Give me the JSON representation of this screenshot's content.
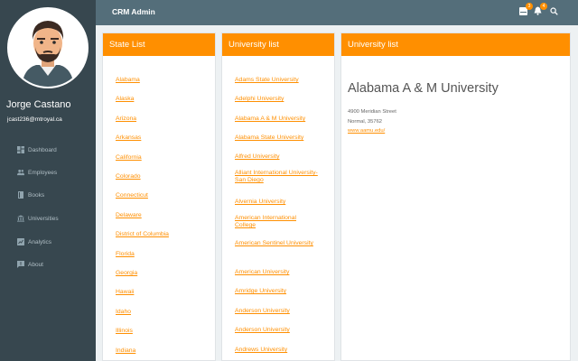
{
  "user": {
    "name": "Jorge Castano",
    "email": "jcast236@mtroyal.ca"
  },
  "app": {
    "title": "CRM Admin"
  },
  "topbar": {
    "badge_mail": "3",
    "badge_bell": "4"
  },
  "nav": {
    "items": [
      {
        "label": "Dashboard",
        "icon": "dashboard-icon"
      },
      {
        "label": "Employees",
        "icon": "people-icon"
      },
      {
        "label": "Books",
        "icon": "book-icon"
      },
      {
        "label": "Universities",
        "icon": "university-icon"
      },
      {
        "label": "Analytics",
        "icon": "analytics-icon"
      },
      {
        "label": "About",
        "icon": "chat-icon"
      }
    ]
  },
  "states": {
    "title": "State List",
    "items": [
      "Alabama",
      "Alaska",
      "Arizona",
      "Arkansas",
      "California",
      "Colorado",
      "Connecticut",
      "Delaware",
      "District of Columbia",
      "Florida",
      "Georgia",
      "Hawaii",
      "Idaho",
      "Illinois",
      "Indiana"
    ]
  },
  "universities": {
    "title": "University list",
    "items": [
      "Adams State University",
      "Adelphi University",
      "Alabama A & M University",
      "Alabama State University",
      "Alfred University",
      "Alliant International University-San Diego",
      "Alvernia University",
      "American International College",
      "American Sentinel University",
      "American University",
      "Amridge University",
      "Anderson University",
      "Anderson University",
      "Andrews University"
    ]
  },
  "detail": {
    "title": "University list",
    "name": "Alabama A & M University",
    "address": "4900 Meridian Street",
    "city": "Normal, 35762",
    "url": "www.aamu.edu/"
  },
  "colors": {
    "accent": "#ff8f00",
    "sidebar": "#37474f",
    "topbar": "#546e7a"
  }
}
